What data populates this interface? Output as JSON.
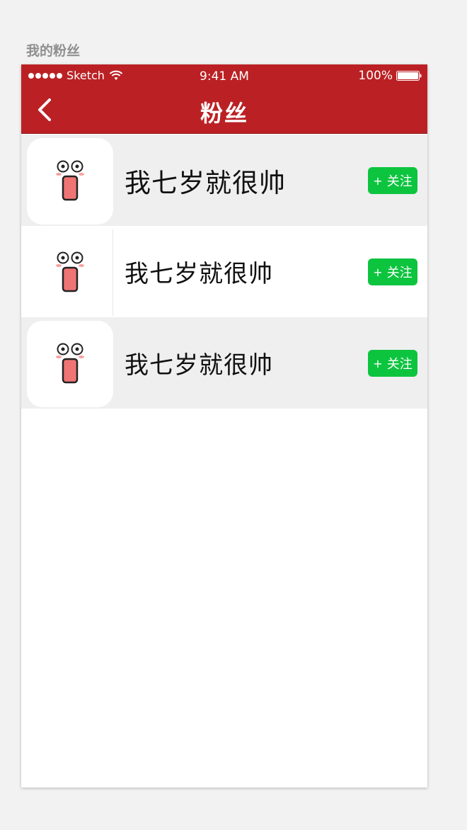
{
  "artboard": {
    "label": "我的粉丝"
  },
  "status_bar": {
    "carrier": "Sketch",
    "time": "9:41 AM",
    "battery": "100%"
  },
  "navbar": {
    "title": "粉丝",
    "back_icon": "chevron-left-icon",
    "background": "#bb2124"
  },
  "fans": [
    {
      "name": "我七岁就很帅",
      "follow_plus": "+",
      "follow_label": "关注",
      "avatar_icon": "cartoon-face-icon"
    },
    {
      "name": "我七岁就很帅",
      "follow_plus": "+",
      "follow_label": "关注",
      "avatar_icon": "cartoon-face-icon"
    },
    {
      "name": "我七岁就很帅",
      "follow_plus": "+",
      "follow_label": "关注",
      "avatar_icon": "cartoon-face-icon"
    }
  ],
  "colors": {
    "follow_button": "#0dc43f",
    "row_alt": "#efefef"
  }
}
